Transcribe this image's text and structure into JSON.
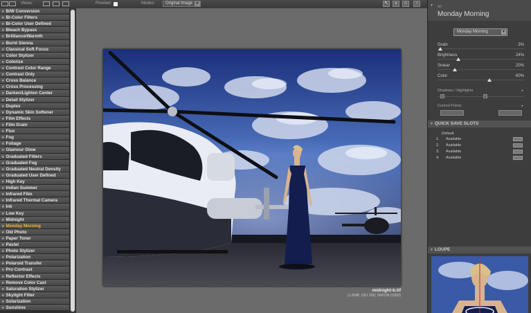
{
  "toolbar": {
    "views_label": "Views:",
    "preview_label": "Preview:",
    "modes_label": "Modes:",
    "modes_value": "Original Image"
  },
  "filters": [
    "B/W Conversion",
    "Bi-Color Filters",
    "Bi-Color User Defined",
    "Bleach Bypass",
    "Brilliance/Warmth",
    "Burnt Sienna",
    "Classical Soft Focus",
    "Color Stylizer",
    "Colorize",
    "Contrast Color Range",
    "Contrast Only",
    "Cross Balance",
    "Cross Processing",
    "Darken/Lighten Center",
    "Detail Stylizer",
    "Duplex",
    "Dynamic Skin Softener",
    "Film Effects",
    "Film Grain",
    "Flux",
    "Fog",
    "Foliage",
    "Glamour Glow",
    "Graduated Filters",
    "Graduated Fog",
    "Graduated Neutral Density",
    "Graduated User Defined",
    "High Key",
    "Indian Summer",
    "Infrared Film",
    "Infrared Thermal Camera",
    "Ink",
    "Low Key",
    "Midnight",
    "Monday Morning",
    "Old Photo",
    "Paper Toner",
    "Pastel",
    "Photo Stylizer",
    "Polarization",
    "Polaroid Transfer",
    "Pro Contrast",
    "Reflector Effects",
    "Remove Color Cast",
    "Saturation Stylizer",
    "Skylight Filter",
    "Solarization",
    "Sunshine"
  ],
  "active_filter_index": 34,
  "image": {
    "file_name": "midnight-b.tif",
    "meta": "(1.6MP, ISO 200, NIKON D200)"
  },
  "panel": {
    "title_small": "All",
    "title": "Monday Morning",
    "preset": "Monday Morning",
    "sliders": [
      {
        "label": "Grain",
        "value": "3%",
        "level": 0.03
      },
      {
        "label": "Brightness",
        "value": "24%",
        "level": 0.24
      },
      {
        "label": "Smear",
        "value": "20%",
        "level": 0.2
      },
      {
        "label": "Color",
        "value": "60%",
        "level": 0.6
      }
    ],
    "shadows_label": "Shadows / Highlights",
    "control_points_label": "Control Points"
  },
  "quick_save": {
    "header": "QUICK SAVE SLOTS",
    "default_label": "Default",
    "slots": [
      {
        "num": "1.",
        "status": "Available"
      },
      {
        "num": "2.",
        "status": "Available"
      },
      {
        "num": "3.",
        "status": "Available"
      },
      {
        "num": "4.",
        "status": "Available"
      }
    ]
  },
  "loupe": {
    "header": "LOUPE"
  },
  "colors": {
    "active_filter": "#f5b62b",
    "sky_top": "#1e3a8a",
    "sky_mid": "#5b7fc4"
  }
}
